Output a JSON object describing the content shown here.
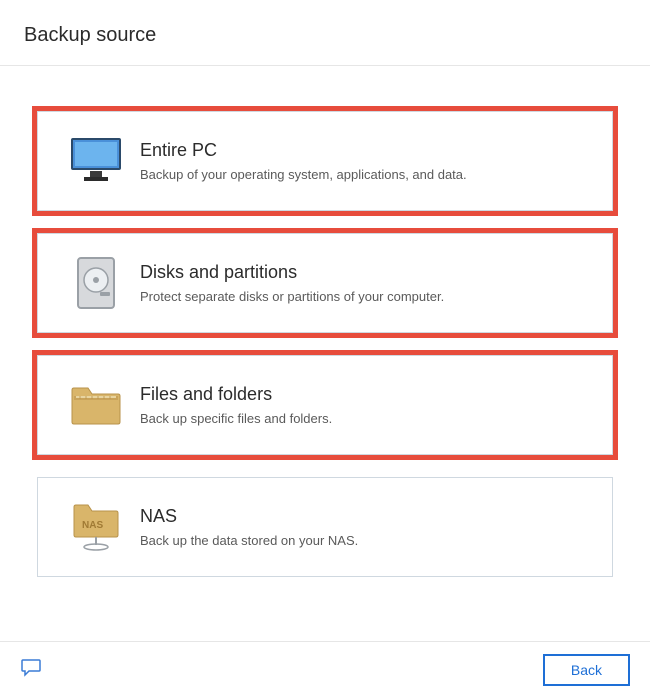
{
  "header": {
    "title": "Backup source"
  },
  "options": [
    {
      "key": "entire-pc",
      "title": "Entire PC",
      "desc": "Backup of your operating system, applications, and data.",
      "highlight": true,
      "icon": "monitor-icon"
    },
    {
      "key": "disks-partitions",
      "title": "Disks and partitions",
      "desc": "Protect separate disks or partitions of your computer.",
      "highlight": true,
      "icon": "disk-icon"
    },
    {
      "key": "files-folders",
      "title": "Files and folders",
      "desc": "Back up specific files and folders.",
      "highlight": true,
      "icon": "folder-icon"
    },
    {
      "key": "nas",
      "title": "NAS",
      "desc": "Back up the data stored on your NAS.",
      "highlight": false,
      "icon": "nas-icon"
    }
  ],
  "footer": {
    "back_label": "Back"
  }
}
